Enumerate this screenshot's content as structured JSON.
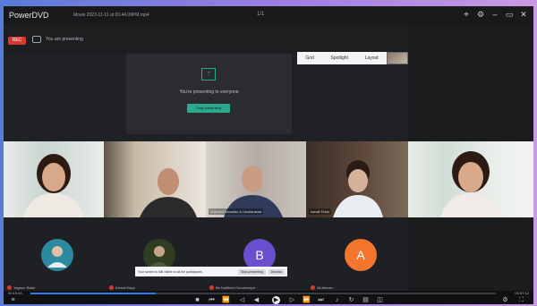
{
  "app": {
    "brand": "PowerDVD",
    "filename": "Movie 2023-11-11 at 03.44.09PM.mp4",
    "mid_indicator": "1/1"
  },
  "window_controls": {
    "icons": [
      "pin-icon",
      "settings-icon",
      "minimize-icon",
      "restore-icon",
      "close-icon"
    ]
  },
  "meeting": {
    "record_label": "REC",
    "presenting_label": "You are presenting",
    "view_controls": [
      "Grid",
      "Spotlight",
      "Layout"
    ],
    "share": {
      "message": "You're presenting to everyone",
      "button": "Stop presenting"
    },
    "tiles": [
      {
        "name": ""
      },
      {
        "name": ""
      },
      {
        "name": "Gokmen Aslantas & Uluslararasi"
      },
      {
        "name": "Ismail Tekin"
      }
    ],
    "avatars": [
      {
        "initial": "",
        "label": "Yagmur Batur",
        "color": "#2b8aa0"
      },
      {
        "initial": "",
        "label": "Kemal Kaya",
        "color": "#2f3d22"
      },
      {
        "initial": "B",
        "label": "Bir Katilimci Gorunmuyor",
        "color": "#6a4fcf"
      },
      {
        "initial": "A",
        "label": "Ali Akman",
        "color": "#f4752d"
      }
    ],
    "notification": {
      "text": "Your screen is still visible to all the participants",
      "button1": "Stop presenting",
      "button2": "Dismiss"
    }
  },
  "player": {
    "time_elapsed": "00:15:43",
    "time_total": "00:57:12",
    "progress": 0.27,
    "buttons": [
      "stop-icon",
      "previous-icon",
      "rewind-icon",
      "play-icon",
      "forward-icon",
      "next-icon",
      "volume-icon",
      "repeat-icon",
      "subtitle-icon",
      "settings-icon",
      "fullscreen-icon"
    ]
  }
}
